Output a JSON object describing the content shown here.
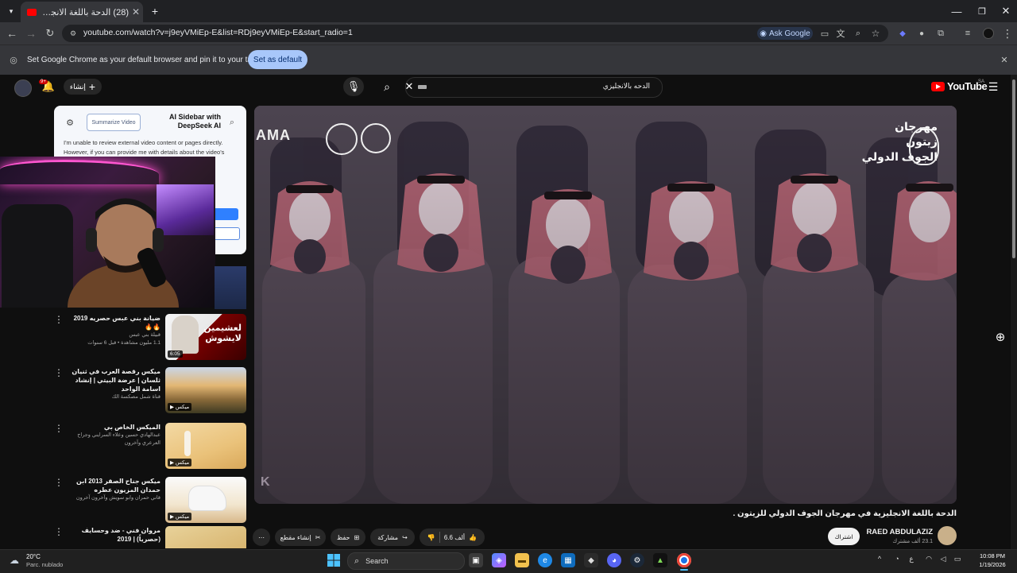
{
  "browser": {
    "tab_title": "(28) الدحة باللغة الانجليزية في من",
    "url": "youtube.com/watch?v=j9eyVMiEp-E&list=RDj9eyVMiEp-E&start_radio=1",
    "ask_google": "Ask Google",
    "infobar_text": "Set Google Chrome as your default browser and pin it to your taskbar",
    "set_default": "Set as default"
  },
  "youtube": {
    "search_query": "الدحه بالانجليزي",
    "logo_text": "YouTube",
    "country": "SA",
    "create_label": "إنشاء",
    "notif_count": "9+"
  },
  "ai_sidebar": {
    "title": "AI Sidebar with DeepSeek AI",
    "summarize": "Summarize Video",
    "message": "I'm unable to review external video content or pages directly. However, if you can provide me with details about the video's create a formation. ssist you ordingly"
  },
  "recommendations": [
    {
      "title": "ضيانة بني عبس حصريه 2019 🔥🔥",
      "channel": "قبيلة بني عبس",
      "meta": "1.1 مليون مشاهدة • قبل 6 سنوات",
      "badge": "6:05",
      "thumb_text": "لعشيمين لايشوش"
    },
    {
      "title": "ميكس رقصة العرب في ثنيان ثلسان | عرضة البيتي | إنشاد اسامة الواحد",
      "channel": "قناة شمل مصكسة الك",
      "meta": "",
      "badge": "ميكس"
    },
    {
      "title": "الميكس الخاص بي",
      "channel": "عبدالهادي حسين وعلاء السرايني وجراح العرعري وآخرون",
      "meta": "",
      "badge": "ميكس"
    },
    {
      "title": "ميكس جناح الصقر 2013 ابن حمدان المزيون عطره",
      "channel": "قاني حمران وابو سويش وآخرون آخرون",
      "meta": "",
      "badge": "ميكس"
    },
    {
      "title": "مروان فني - ضد وحسايف (حصرياً) | 2019",
      "channel": "",
      "meta": "",
      "badge": ""
    }
  ],
  "video": {
    "logo_right_lines": [
      "مهرجان",
      "زيتون",
      "الجوف الدولي"
    ],
    "logo_left": "AMA",
    "title": "الدحة باللغة الانجليزية في مهرجان الجوف الدولي للزيتون .",
    "channel": "RAED ABDULAZIZ",
    "subscribers": "23.1 ألف مشترك",
    "subscribe": "اشتراك",
    "likes": "6.6 ألف",
    "share": "مشاركة",
    "save": "حفظ",
    "clip": "إنشاء مقطع"
  },
  "taskbar": {
    "temp": "20°C",
    "weather": "Parc. nublado",
    "search": "Search",
    "time": "10:08 PM",
    "date": "1/19/2026",
    "lang": "ع"
  },
  "colors": {
    "chrome_dark": "#202124",
    "chrome_toolbar": "#35363a",
    "yt_bg": "#0f0f0f",
    "yt_red": "#ff0000",
    "button_blue": "#a8c7fa"
  }
}
